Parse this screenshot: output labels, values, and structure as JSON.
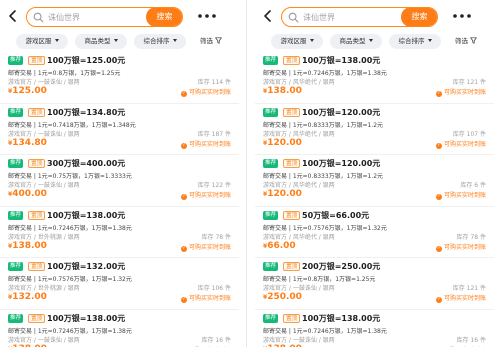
{
  "search": {
    "placeholder": "诛仙世界",
    "button_label": "搜索"
  },
  "filters": {
    "region": "游戏区服",
    "type": "商品类型",
    "sort": "综合排序",
    "filter": "筛选"
  },
  "tags": {
    "rec": "推荐",
    "top": "置顶"
  },
  "badge_text": "可购买实时到账",
  "left": {
    "items": [
      {
        "title": "100万银=125.00元",
        "line1": "邮寄交易 | 1元=0.8万银，1万银=1.25元",
        "line2": "游戏官方 / 一鼓诛仙 / 银两",
        "stock": "库存 114 件",
        "price": "125.00"
      },
      {
        "title": "100万银=134.80元",
        "line1": "邮寄交易 | 1元=0.7418万银，1万银=1.348元",
        "line2": "游戏官方 / 一鼓诛仙 / 银两",
        "stock": "库存 187 件",
        "price": "134.80"
      },
      {
        "title": "300万银=400.00元",
        "line1": "邮寄交易 | 1元=0.75万银，1万银=1.3333元",
        "line2": "游戏官方 / 一鼓诛仙 / 银两",
        "stock": "库存 122 件",
        "price": "400.00"
      },
      {
        "title": "100万银=138.00元",
        "line1": "邮寄交易 | 1元=0.7246万银，1万银=1.38元",
        "line2": "游戏官方 / 世外桃源 / 银两",
        "stock": "库存 78 件",
        "price": "138.00"
      },
      {
        "title": "100万银=132.00元",
        "line1": "邮寄交易 | 1元=0.7576万银，1万银=1.32元",
        "line2": "游戏官方 / 世外桃源 / 银两",
        "stock": "库存 106 件",
        "price": "132.00"
      },
      {
        "title": "100万银=138.00元",
        "line1": "邮寄交易 | 1元=0.7246万银，1万银=1.38元",
        "line2": "游戏官方 / 一鼓诛仙 / 银两",
        "stock": "库存 16 件",
        "price": "138.00"
      }
    ]
  },
  "right": {
    "items": [
      {
        "title": "100万银=138.00元",
        "line1": "邮寄交易 | 1元=0.7246万银，1万银=1.38元",
        "line2": "游戏官方 / 风华绝代 / 银两",
        "stock": "库存 121 件",
        "price": "138.00"
      },
      {
        "title": "100万银=120.00元",
        "line1": "邮寄交易 | 1元=0.8333万银，1万银=1.2元",
        "line2": "游戏官方 / 风华绝代 / 银两",
        "stock": "库存 107 件",
        "price": "120.00"
      },
      {
        "title": "100万银=120.00元",
        "line1": "邮寄交易 | 1元=0.8333万银，1万银=1.2元",
        "line2": "游戏官方 / 风华绝代 / 银两",
        "stock": "库存 6 件",
        "price": "120.00"
      },
      {
        "title": "50万银=66.00元",
        "line1": "邮寄交易 | 1元=0.7576万银，1万银=1.32元",
        "line2": "游戏官方 / 风华绝代 / 银两",
        "stock": "库存 78 件",
        "price": "66.00"
      },
      {
        "title": "200万银=250.00元",
        "line1": "邮寄交易 | 1元=0.8万银，1万银=1.25元",
        "line2": "游戏官方 / 一鼓诛仙 / 银两",
        "stock": "库存 121 件",
        "price": "250.00"
      },
      {
        "title": "100万银=138.00元",
        "line1": "邮寄交易 | 1元=0.7246万银，1万银=1.38元",
        "line2": "游戏官方 / 一鼓诛仙 / 银两",
        "stock": "库存 16 件",
        "price": "138.00"
      }
    ]
  }
}
